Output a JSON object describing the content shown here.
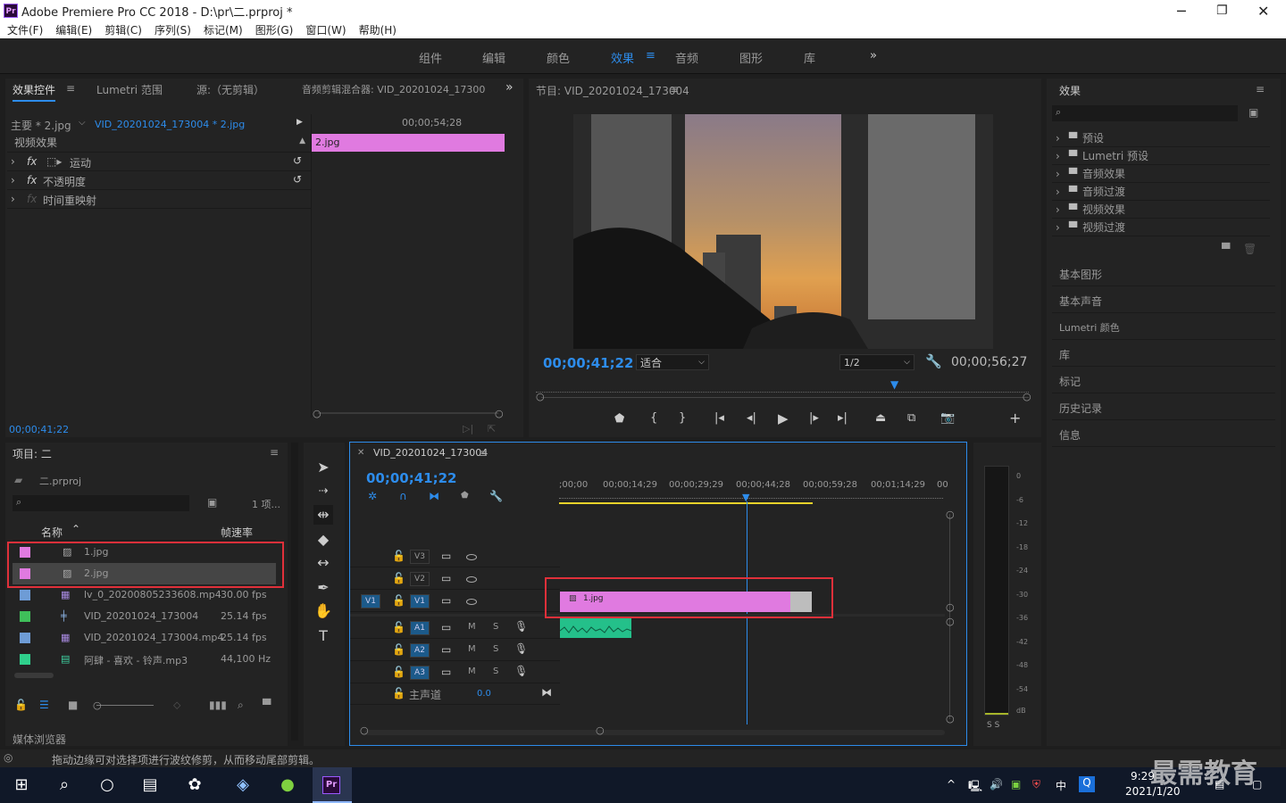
{
  "window": {
    "app_icon": "Pr",
    "title": "Adobe Premiere Pro CC 2018 - D:\\pr\\二.prproj *"
  },
  "menu": [
    "文件(F)",
    "编辑(E)",
    "剪辑(C)",
    "序列(S)",
    "标记(M)",
    "图形(G)",
    "窗口(W)",
    "帮助(H)"
  ],
  "workspaces": [
    "组件",
    "编辑",
    "颜色",
    "效果",
    "音频",
    "图形",
    "库"
  ],
  "active_workspace": "效果",
  "effect_controls": {
    "tabs": [
      "效果控件",
      "Lumetri 范围",
      "源:（无剪辑）",
      "音频剪辑混合器: VID_20201024_17300"
    ],
    "master": "主要 * 2.jpg",
    "clip": "VID_20201024_173004 * 2.jpg",
    "timecode_head": "00;00;54;28",
    "clip_bar": "2.jpg",
    "section": "视频效果",
    "effects": [
      "运动",
      "不透明度",
      "时间重映射"
    ],
    "fx": "fx",
    "timecode": "00;00;41;22"
  },
  "program": {
    "title": "节目: VID_20201024_173004",
    "timecode": "00;00;41;22",
    "fit": "适合",
    "resolution": "1/2",
    "duration": "00;00;56;27",
    "colors": {
      "sky": "#c98a4b",
      "building": "#1a1a1a",
      "accent": "#2d8ceb"
    }
  },
  "effects_panel": {
    "title": "效果",
    "items": [
      "预设",
      "Lumetri 预设",
      "音频效果",
      "音频过渡",
      "视频效果",
      "视频过渡"
    ],
    "others": [
      "基本图形",
      "基本声音",
      "Lumetri 颜色",
      "库",
      "标记",
      "历史记录",
      "信息"
    ]
  },
  "project": {
    "title": "项目: 二",
    "file": "二.prproj",
    "count": "1 项...",
    "col_name": "名称",
    "col_fps": "帧速率",
    "rows": [
      {
        "name": "1.jpg",
        "fps": "",
        "color": "#e07ae0"
      },
      {
        "name": "2.jpg",
        "fps": "",
        "color": "#e07ae0"
      },
      {
        "name": "lv_0_20200805233608.mp4",
        "fps": "30.00 fps",
        "color": "#6e9cd6"
      },
      {
        "name": "VID_20201024_173004",
        "fps": "25.14 fps",
        "color": "#3fbf5a"
      },
      {
        "name": "VID_20201024_173004.mp4",
        "fps": "25.14 fps",
        "color": "#6e9cd6"
      },
      {
        "name": "阿肆 - 喜欢 - 铃声.mp3",
        "fps": "44,100 Hz",
        "color": "#2fd08c"
      }
    ],
    "media_browser": "媒体浏览器"
  },
  "timeline": {
    "title": "VID_20201024_173004",
    "timecode": "00;00;41;22",
    "ruler": [
      ";00;00",
      "00;00;14;29",
      "00;00;29;29",
      "00;00;44;28",
      "00;00;59;28",
      "00;01;14;29",
      "00"
    ],
    "video_tracks": [
      "V3",
      "V2",
      "V1"
    ],
    "audio_tracks": [
      "A1",
      "A2",
      "A3"
    ],
    "source_patch": "V1",
    "master": "主声道",
    "master_val": "0.0",
    "clip": "1.jpg",
    "m": "M",
    "s": "S"
  },
  "meter": {
    "labels": [
      "0",
      "-6",
      "-12",
      "-18",
      "-24",
      "-30",
      "-36",
      "-42",
      "-48",
      "-54",
      "dB"
    ],
    "ss": "S S"
  },
  "status": "拖动边缘可对选择项进行波纹修剪，从而移动尾部剪辑。",
  "taskbar": {
    "time": "9:29",
    "date": "2021/1/20",
    "ime": "中",
    "watermark": "最需教育"
  }
}
